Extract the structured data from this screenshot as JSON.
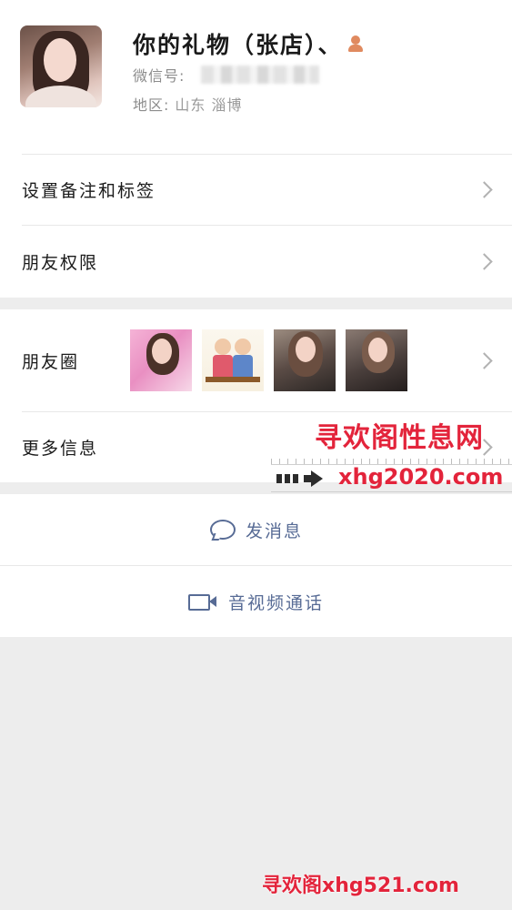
{
  "profile": {
    "name": "你的礼物（张店）、",
    "wechat_label": "微信号:",
    "region_label": "地区:",
    "region_value": "山东 淄博"
  },
  "rows": {
    "remark_tags": "设置备注和标签",
    "friend_permissions": "朋友权限",
    "moments": "朋友圈",
    "more_info": "更多信息"
  },
  "actions": {
    "send_message": "发消息",
    "video_call": "音视频通话"
  },
  "watermarks": {
    "overlay_title": "寻欢阁性息网",
    "overlay_url": "xhg2020.com",
    "footer": "寻欢阁xhg521.com"
  },
  "colors": {
    "link_blue": "#576b95",
    "watermark_red": "#e3243b",
    "background": "#ededed"
  }
}
